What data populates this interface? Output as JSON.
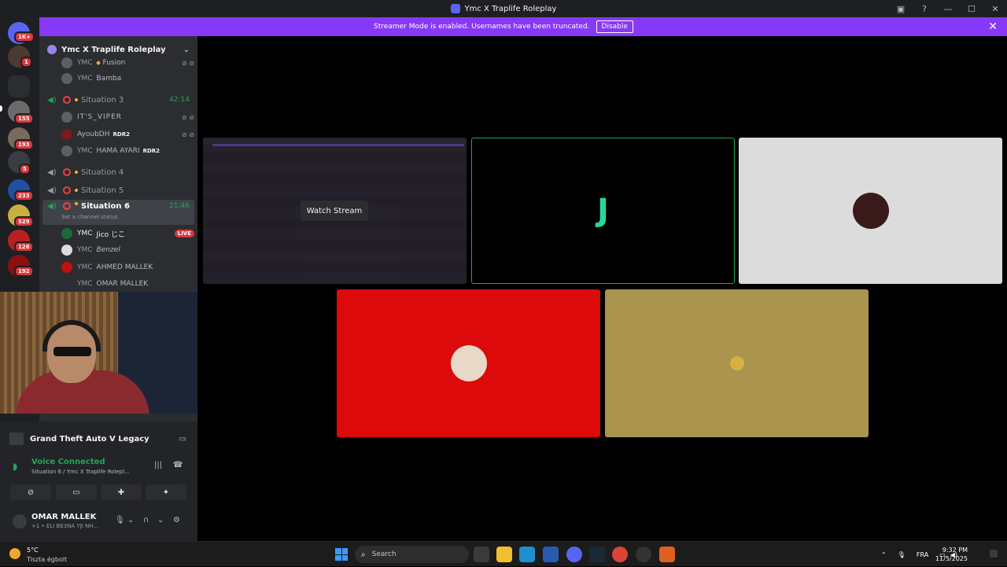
{
  "window": {
    "title": "Ymc X Traplife Roleplay"
  },
  "banner": {
    "message": "Streamer Mode is enabled. Usernames have been truncated.",
    "disable_label": "Disable"
  },
  "guild_rail": {
    "badges": [
      "1K+",
      "1",
      "155",
      "193",
      "5",
      "233",
      "529",
      "126",
      "192"
    ]
  },
  "sidebar": {
    "server_name": "Ymc X Traplife Roleplay",
    "channels": [
      {
        "name": "Situation 3",
        "time": "42:14"
      },
      {
        "name": "Situation 4"
      },
      {
        "name": "Situation 5"
      },
      {
        "name": "Situation 6",
        "time": "21:46",
        "status": "Set a channel status"
      }
    ],
    "users_top": [
      {
        "tag": "YMC",
        "name": "Fusion"
      },
      {
        "tag": "YMC",
        "name": "Bamba"
      }
    ],
    "users_sit3": [
      {
        "tag": "",
        "name": "IT'S_VIPER"
      },
      {
        "tag": "",
        "name": "AyoubDH",
        "game": "RDR2"
      },
      {
        "tag": "YMC",
        "name": "HAMA AYARI",
        "game": "RDR2"
      }
    ],
    "users_sit6": [
      {
        "tag": "YMC",
        "name": "Jico じこ",
        "live": "LIVE"
      },
      {
        "tag": "YMC",
        "name": "Benzel"
      },
      {
        "tag": "YMC",
        "name": "AHMED MALLEK"
      },
      {
        "tag": "YMC",
        "name": "OMAR MALLEK"
      }
    ]
  },
  "panel": {
    "game": "Grand Theft Auto V Legacy",
    "voice_status": "Voice Connected",
    "voice_channel": "Situation 6 / Ymc X Traplife Rolepl...",
    "user_name": "OMAR MALLEK",
    "user_status": "+1 • ELI BE3NA YJI NH..."
  },
  "stage": {
    "watch_stream_label": "Watch Stream"
  },
  "taskbar": {
    "temperature": "5°C",
    "condition": "Tiszta égbolt",
    "search_placeholder": "Search",
    "language": "FRA",
    "time": "9:32 PM",
    "date": "11/5/2025"
  },
  "colors": {
    "accent_green": "#23a55a",
    "banner_purple": "#8838f8",
    "live_red": "#da373c"
  }
}
